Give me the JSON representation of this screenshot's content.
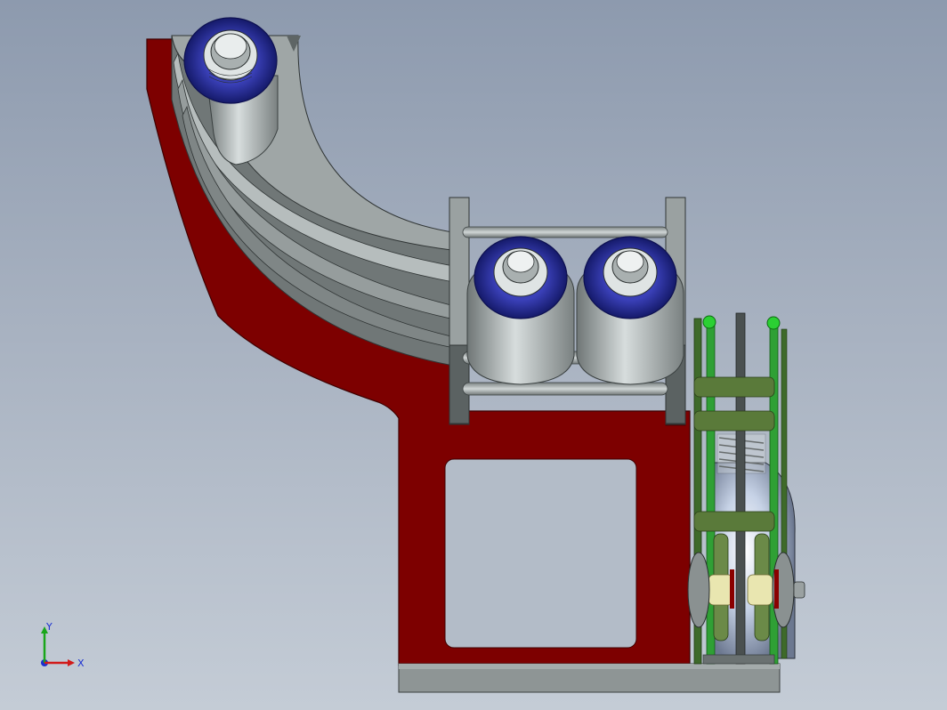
{
  "viewport": {
    "background_top": "#8d9aae",
    "background_bottom": "#c4ccd6"
  },
  "triad": {
    "x_label": "X",
    "y_label": "Y",
    "x_color": "#d11a1a",
    "y_color": "#1aa61a",
    "z_color": "#1a2fd1"
  },
  "colors": {
    "frame": "#7d0000",
    "frame_edge": "#4d0000",
    "metal_light": "#b8bfbf",
    "metal_mid": "#8c9393",
    "metal_dark": "#5e6565",
    "fitting_blue": "#2a2f9a",
    "fitting_blue_dark": "#141a66",
    "linkage_green": "#5a7a3a",
    "bright_green": "#22c22a",
    "cream": "#e9e6b0"
  }
}
